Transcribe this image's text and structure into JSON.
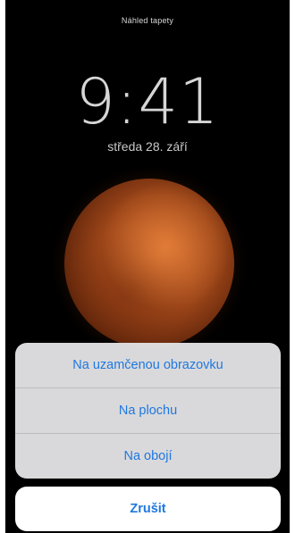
{
  "header": {
    "title": "Náhled tapety"
  },
  "lockscreen": {
    "time": "9:41",
    "date": "středa 28. září"
  },
  "action_sheet": {
    "options": [
      {
        "label": "Na uzamčenou obrazovku"
      },
      {
        "label": "Na plochu"
      },
      {
        "label": "Na obojí"
      }
    ],
    "cancel_label": "Zrušit"
  },
  "colors": {
    "action_text": "#1f78e0",
    "background": "#000000",
    "planet": "#b0531f"
  }
}
